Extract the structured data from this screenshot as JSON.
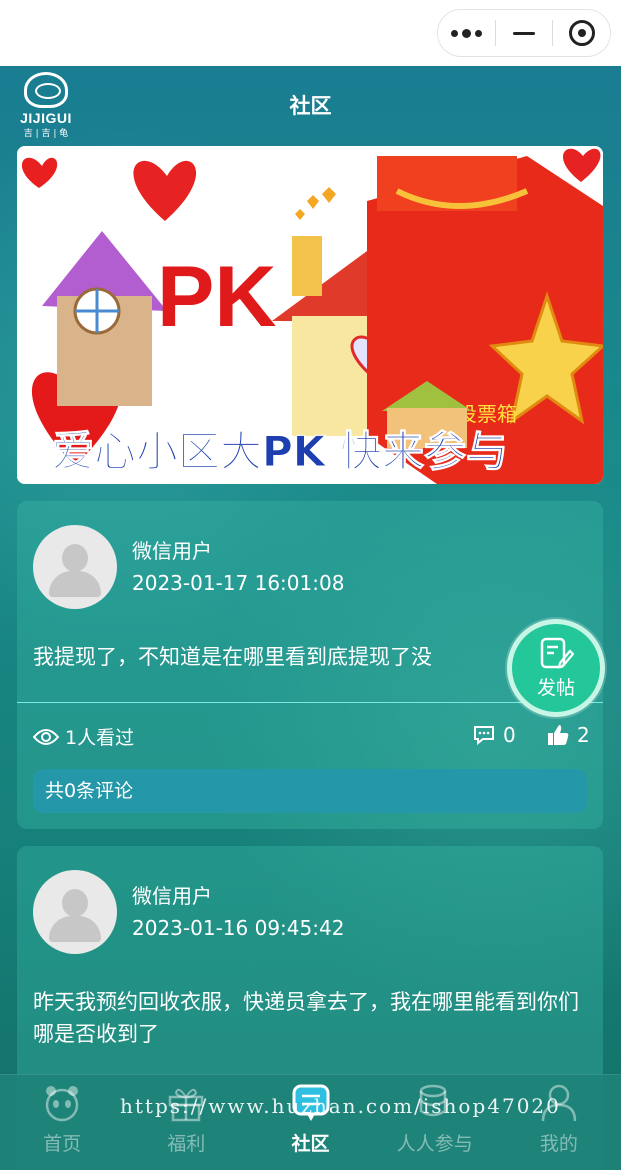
{
  "header": {
    "title": "社区",
    "logo_brand": "JIJIGUI",
    "logo_sub": "吉 | 吉 | 龟"
  },
  "banner": {
    "pk_text": "PK",
    "caption": "爱心小区大PK  快来参与",
    "box_text": "投票箱"
  },
  "posts": [
    {
      "username": "微信用户",
      "time": "2023-01-17 16:01:08",
      "content": "我提现了，不知道是在哪里看到底提现了没",
      "views": "1人看过",
      "comments": "0",
      "likes": "2",
      "comment_summary": "共0条评论"
    },
    {
      "username": "微信用户",
      "time": "2023-01-16 09:45:42",
      "content": "昨天我预约回收衣服，快递员拿去了，我在哪里能看到你们哪是否收到了"
    }
  ],
  "fab": {
    "label": "发帖",
    "icon": "edit-note-icon"
  },
  "tabbar": [
    {
      "label": "首页",
      "icon": "panda-icon"
    },
    {
      "label": "福利",
      "icon": "gift-icon"
    },
    {
      "label": "社区",
      "icon": "chat-icon",
      "active": true
    },
    {
      "label": "人人参与",
      "icon": "coins-icon"
    },
    {
      "label": "我的",
      "icon": "user-icon"
    }
  ],
  "watermark": "https://www.huzhan.com/ishop47020",
  "colors": {
    "background": "#1a8a8a",
    "comment_bar": "#2497a8",
    "fab": "#23c79a",
    "banner_caption": "#1e3fb0"
  }
}
